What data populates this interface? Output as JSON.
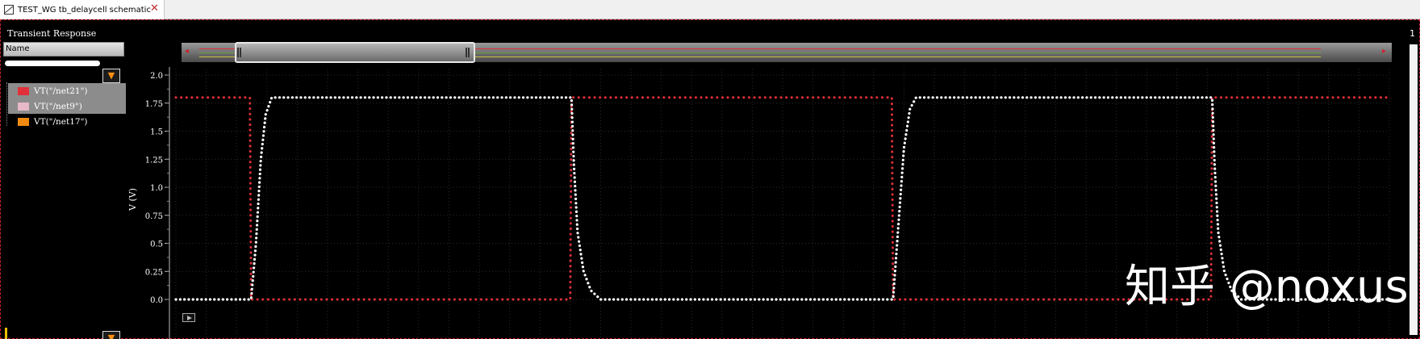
{
  "tab": {
    "label": "TEST_WG tb_delaycell schematic",
    "close": "✕"
  },
  "window": {
    "title": "Transient Response",
    "number": "1"
  },
  "legend": {
    "header": "Name",
    "items": [
      {
        "label": "VT(\"/net21\")",
        "color": "#e0303a",
        "selected": true
      },
      {
        "label": "VT(\"/net9\")",
        "color": "#e6b8c8",
        "selected": true
      },
      {
        "label": "VT(\"/net17\")",
        "color": "#f08a10",
        "selected": false
      }
    ],
    "filter_icon": "filter-funnel-icon"
  },
  "watermark": "知乎 @noxus",
  "chart_data": {
    "type": "line",
    "ylabel": "V (V)",
    "ylim": [
      0,
      2.0
    ],
    "y_ticks": [
      "0.0",
      "0.25",
      "0.5",
      "0.75",
      "1.0",
      "1.25",
      "1.5",
      "1.75",
      "2.0"
    ],
    "x_range": [
      0,
      100
    ],
    "grid": true,
    "series": [
      {
        "name": "VT(\"/net21\")",
        "color": "#e0303a",
        "x": [
          0,
          6.1,
          6.2,
          32.5,
          32.6,
          59.0,
          59.1,
          85.3,
          85.4,
          100
        ],
        "y": [
          1.8,
          1.8,
          0.0,
          0.0,
          1.8,
          1.8,
          0.0,
          0.0,
          1.8,
          1.8
        ]
      },
      {
        "name": "VT(\"/net9\")",
        "color": "#ffffff",
        "x": [
          0,
          6.2,
          6.6,
          7.0,
          7.4,
          7.9,
          32.6,
          32.8,
          33.1,
          33.6,
          34.2,
          35.0,
          59.1,
          59.5,
          60.0,
          60.5,
          61.0,
          85.4,
          85.6,
          85.9,
          86.4,
          87.0,
          87.8,
          100
        ],
        "y": [
          0.0,
          0.0,
          0.5,
          1.25,
          1.65,
          1.8,
          1.8,
          1.2,
          0.6,
          0.25,
          0.08,
          0.0,
          0.0,
          0.6,
          1.35,
          1.7,
          1.8,
          1.8,
          1.2,
          0.6,
          0.25,
          0.08,
          0.0,
          0.0
        ]
      },
      {
        "name": "VT(\"/net17\")",
        "color": "#f08a10",
        "x": [],
        "y": []
      }
    ]
  }
}
